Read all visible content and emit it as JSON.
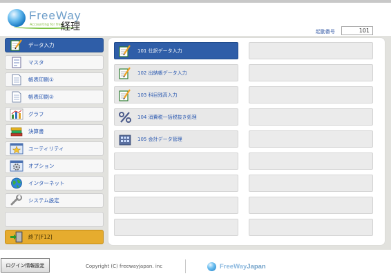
{
  "header": {
    "logo_name": "FreeWay",
    "logo_tagline": "Accounting for free",
    "logo_kanji": "経理",
    "startup_label": "起動番号",
    "startup_value": "101"
  },
  "sidebar": {
    "items": [
      {
        "label": "データ入力",
        "icon": "notepad-pencil-icon",
        "active": true
      },
      {
        "label": "マスタ",
        "icon": "master-document-icon"
      },
      {
        "label": "帳表印刷①",
        "icon": "printed-form-icon"
      },
      {
        "label": "帳表印刷②",
        "icon": "printed-form-icon"
      },
      {
        "label": "グラフ",
        "icon": "bar-chart-icon"
      },
      {
        "label": "決算書",
        "icon": "books-stack-icon"
      },
      {
        "label": "ユーティリティ",
        "icon": "star-window-icon"
      },
      {
        "label": "オプション",
        "icon": "gear-window-icon"
      },
      {
        "label": "インターネット",
        "icon": "globe-icon"
      },
      {
        "label": "システム設定",
        "icon": "wrench-icon"
      },
      {
        "label": ""
      },
      {
        "label": "終了[F12]",
        "icon": "exit-door-icon"
      }
    ]
  },
  "tiles": [
    {
      "label": "101 仕訳データ入力",
      "icon": "notepad-pencil-icon",
      "active": true
    },
    {
      "label": "102 出納帳データ入力",
      "icon": "notepad-pencil-icon"
    },
    {
      "label": "103 科目残高入力",
      "icon": "notepad-pencil-icon"
    },
    {
      "label": "104 消費税一括税抜き処理",
      "icon": "percent-icon"
    },
    {
      "label": "105 会計データ管理",
      "icon": "database-server-icon"
    }
  ],
  "footer": {
    "login_button": "ログイン情報設定",
    "copyright": "Copyright (C) freewayjapan. inc",
    "brand_free": "FreeWay",
    "brand_japan": "Japan"
  },
  "colors": {
    "accent_blue": "#2f5ea8",
    "exit_orange": "#e6ac2e",
    "link_blue": "#2a58b0"
  }
}
